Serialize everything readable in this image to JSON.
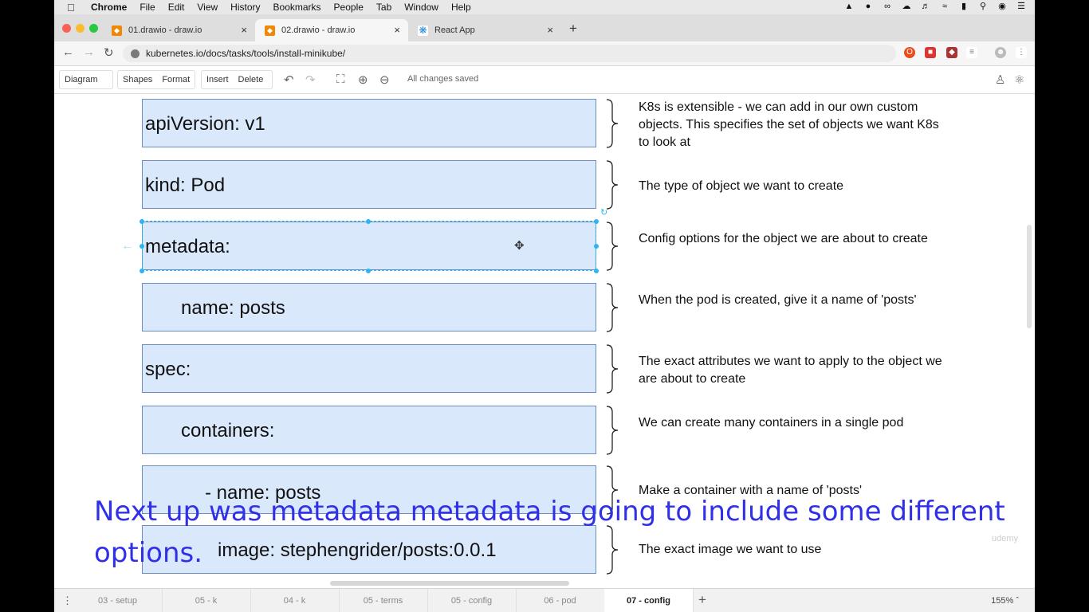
{
  "menubar": {
    "app": "Chrome",
    "items": [
      "File",
      "Edit",
      "View",
      "History",
      "Bookmarks",
      "People",
      "Tab",
      "Window",
      "Help"
    ]
  },
  "tabs": [
    {
      "title": "01.drawio - draw.io",
      "icon": "drawio-icon",
      "icon_color": "#f08705"
    },
    {
      "title": "02.drawio - draw.io",
      "icon": "drawio-icon",
      "icon_color": "#f08705"
    },
    {
      "title": "React App",
      "icon": "react-icon",
      "icon_color": "#61dafb"
    }
  ],
  "address": {
    "url": "kubernetes.io/docs/tasks/tools/install-minikube/"
  },
  "toolbar": {
    "diagram": "Diagram",
    "shapes": "Shapes",
    "format": "Format",
    "insert": "Insert",
    "delete": "Delete",
    "status": "All changes saved"
  },
  "diagram": {
    "boxes": [
      {
        "text": "apiVersion: v1",
        "note": "K8s is extensible - we can add in our own custom objects.  This specifies the set of objects we want K8s to look at"
      },
      {
        "text": "kind: Pod",
        "note": "The type of object we want to create"
      },
      {
        "text": "metadata:",
        "note": "Config options for the object we are about to create"
      },
      {
        "text": "name: posts",
        "note": "When the pod is created, give it a name of 'posts'"
      },
      {
        "text": "spec:",
        "note": "The exact attributes we want to apply to the object we are about to create"
      },
      {
        "text": "containers:",
        "note": "We can create many containers in a single pod"
      },
      {
        "text": "- name: posts",
        "note": "Make a container with a name of 'posts'"
      },
      {
        "text": "image: stephengrider/posts:0.0.1",
        "note": "The exact image we want to use"
      }
    ],
    "fill_color": "#dae8fc",
    "stroke_color": "#6c8ebf"
  },
  "pages": [
    "03 - setup",
    "05 - k",
    "04 - k",
    "05 - terms",
    "05 - config",
    "06 - pod",
    "07 - config"
  ],
  "active_page": "07 - config",
  "zoom": "155%",
  "subtitle": "Next up was metadata metadata is going to include some different options.",
  "watermark": "udemy"
}
